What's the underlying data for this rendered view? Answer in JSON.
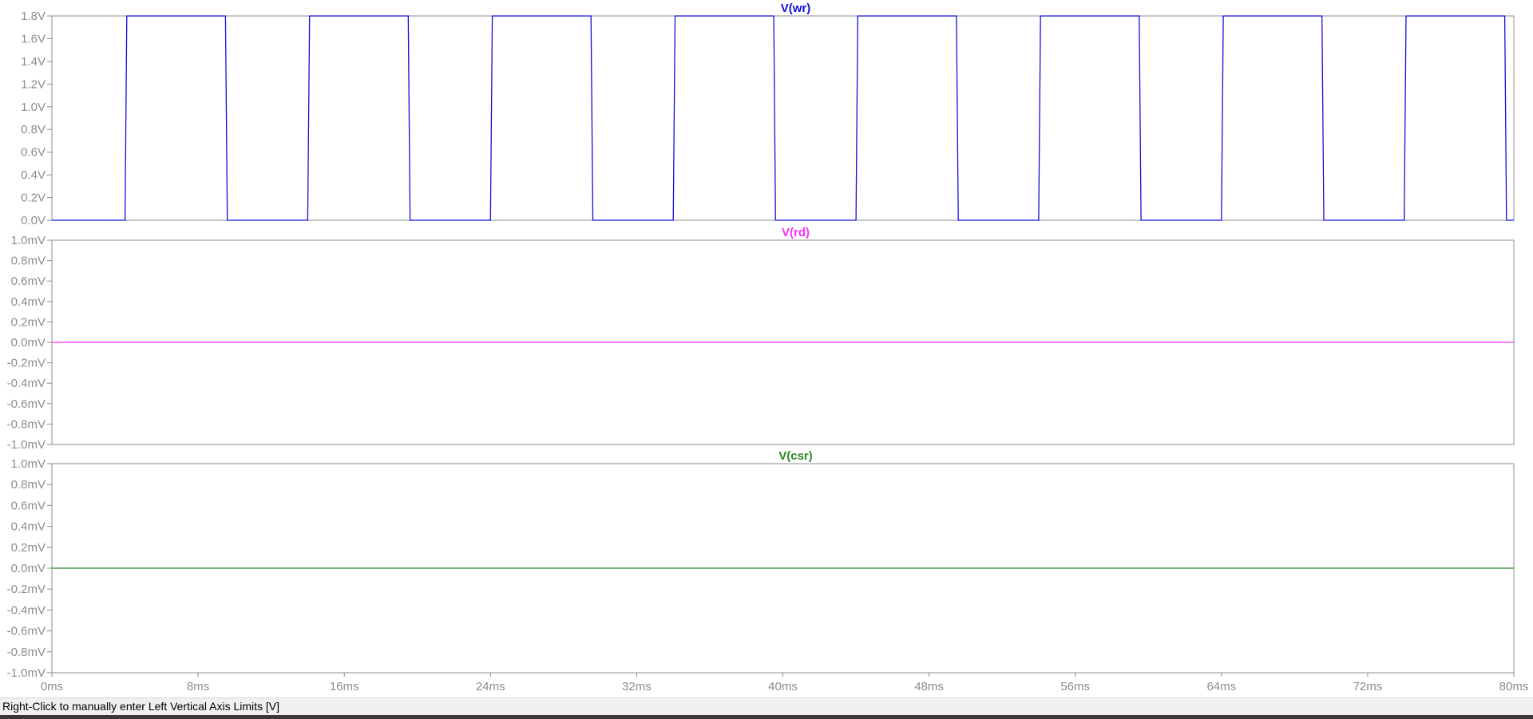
{
  "status_bar": {
    "text": "Right-Click to manually enter Left Vertical Axis Limits [V]"
  },
  "colors": {
    "wr": "#1010e0",
    "rd": "#ff2cff",
    "csr": "#2a8a2a",
    "axis_text": "#8c8c8c",
    "frame": "#8c8c8c"
  },
  "chart_data": [
    {
      "type": "line",
      "title": "V(wr)",
      "x_unit": "ms",
      "xlim": [
        0,
        80
      ],
      "ylim": [
        0,
        1.8
      ],
      "y_ticks": [
        "0.0V",
        "0.2V",
        "0.4V",
        "0.6V",
        "0.8V",
        "1.0V",
        "1.2V",
        "1.4V",
        "1.6V",
        "1.8V"
      ],
      "y_tick_values": [
        0,
        0.2,
        0.4,
        0.6,
        0.8,
        1.0,
        1.2,
        1.4,
        1.6,
        1.8
      ],
      "series": [
        {
          "color": "#1010e0",
          "x": [
            0,
            4.0,
            4.1,
            9.5,
            9.6,
            14.0,
            14.1,
            19.5,
            19.6,
            24.0,
            24.1,
            29.5,
            29.6,
            34.0,
            34.1,
            39.5,
            39.6,
            44.0,
            44.1,
            49.5,
            49.6,
            54.0,
            54.1,
            59.5,
            59.6,
            64.0,
            64.1,
            69.5,
            69.6,
            74.0,
            74.1,
            79.5,
            79.6,
            80
          ],
          "y": [
            0,
            0,
            1.8,
            1.8,
            0,
            0,
            1.8,
            1.8,
            0,
            0,
            1.8,
            1.8,
            0,
            0,
            1.8,
            1.8,
            0,
            0,
            1.8,
            1.8,
            0,
            0,
            1.8,
            1.8,
            0,
            0,
            1.8,
            1.8,
            0,
            0,
            1.8,
            1.8,
            0,
            0
          ]
        }
      ]
    },
    {
      "type": "line",
      "title": "V(rd)",
      "x_unit": "ms",
      "xlim": [
        0,
        80
      ],
      "ylim": [
        -1.0,
        1.0
      ],
      "y_ticks": [
        "-1.0mV",
        "-0.8mV",
        "-0.6mV",
        "-0.4mV",
        "-0.2mV",
        "0.0mV",
        "0.2mV",
        "0.4mV",
        "0.6mV",
        "0.8mV",
        "1.0mV"
      ],
      "y_tick_values": [
        -1.0,
        -0.8,
        -0.6,
        -0.4,
        -0.2,
        0,
        0.2,
        0.4,
        0.6,
        0.8,
        1.0
      ],
      "series": [
        {
          "color": "#ff2cff",
          "x": [
            0,
            80
          ],
          "y": [
            0,
            0
          ]
        }
      ]
    },
    {
      "type": "line",
      "title": "V(csr)",
      "x_unit": "ms",
      "xlim": [
        0,
        80
      ],
      "ylim": [
        -1.0,
        1.0
      ],
      "y_ticks": [
        "-1.0mV",
        "-0.8mV",
        "-0.6mV",
        "-0.4mV",
        "-0.2mV",
        "0.0mV",
        "0.2mV",
        "0.4mV",
        "0.6mV",
        "0.8mV",
        "1.0mV"
      ],
      "y_tick_values": [
        -1.0,
        -0.8,
        -0.6,
        -0.4,
        -0.2,
        0,
        0.2,
        0.4,
        0.6,
        0.8,
        1.0
      ],
      "x_ticks": [
        "0ms",
        "8ms",
        "16ms",
        "24ms",
        "32ms",
        "40ms",
        "48ms",
        "56ms",
        "64ms",
        "72ms",
        "80ms"
      ],
      "x_tick_values": [
        0,
        8,
        16,
        24,
        32,
        40,
        48,
        56,
        64,
        72,
        80
      ],
      "series": [
        {
          "color": "#2a8a2a",
          "x": [
            0,
            80
          ],
          "y": [
            0,
            0
          ]
        }
      ]
    }
  ]
}
